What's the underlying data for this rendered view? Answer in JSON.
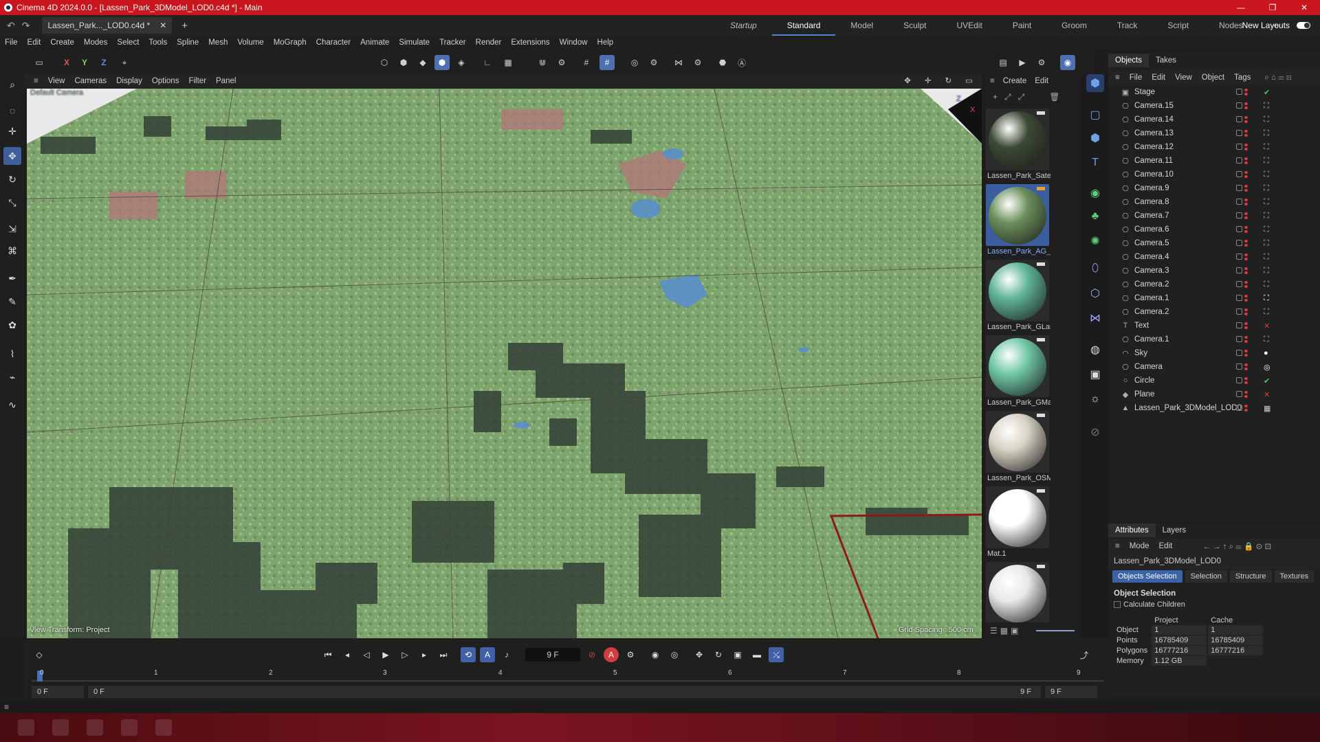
{
  "window": {
    "title": "Cinema 4D 2024.0.0 - [Lassen_Park_3DModel_LOD0.c4d *] - Main",
    "controls": [
      "—",
      "❐",
      "✕"
    ]
  },
  "tabbar": {
    "doc_tab": "Lassen_Park..._LOD0.c4d *",
    "close": "✕",
    "add": "+"
  },
  "layouts": {
    "items": [
      "Startup",
      "Standard",
      "Model",
      "Sculpt",
      "UVEdit",
      "Paint",
      "Groom",
      "Track",
      "Script",
      "Nodes"
    ],
    "add": "+",
    "new_layouts": "New Layouts"
  },
  "menu": [
    "File",
    "Edit",
    "Create",
    "Modes",
    "Select",
    "Tools",
    "Spline",
    "Mesh",
    "Volume",
    "MoGraph",
    "Character",
    "Animate",
    "Simulate",
    "Tracker",
    "Render",
    "Extensions",
    "Window",
    "Help"
  ],
  "toolbar": {
    "x": "X",
    "y": "Y",
    "z": "Z"
  },
  "viewport": {
    "menu": [
      "View",
      "Cameras",
      "Display",
      "Options",
      "Filter",
      "Panel"
    ],
    "view_transform": "View Transform: Project",
    "grid_spacing": "Grid Spacing : 500 cm",
    "camera_label": "Default Camera",
    "axis_z": "Z",
    "axis_x": "X"
  },
  "materials": {
    "menu": [
      "Create",
      "Edit"
    ],
    "items": [
      {
        "name": "Lassen_Park_Satel",
        "color": "#3c4a34"
      },
      {
        "name": "Lassen_Park_AG_L",
        "color": "#6a8f5a"
      },
      {
        "name": "Lassen_Park_GLan",
        "color": "#5fb49a"
      },
      {
        "name": "Lassen_Park_GMa",
        "color": "#6fc8a6"
      },
      {
        "name": "Lassen_Park_OSM",
        "color": "#d8d2c4"
      },
      {
        "name": "Mat.1",
        "color": "#ffffff"
      },
      {
        "name": "",
        "color": "#e8e8e8"
      }
    ]
  },
  "objects_panel": {
    "tabs": [
      "Objects",
      "Takes"
    ],
    "menu": [
      "File",
      "Edit",
      "View",
      "Object",
      "Tags"
    ],
    "items": [
      {
        "name": "Stage",
        "icon": "stage-icon",
        "glyph": "▣",
        "tag": "✔",
        "tag_color": "#3fd06a"
      },
      {
        "name": "Camera.15",
        "icon": "camera-icon",
        "glyph": "⎔",
        "tag": "⛶",
        "tag_color": "#bbbbbb"
      },
      {
        "name": "Camera.14",
        "icon": "camera-icon",
        "glyph": "⎔",
        "tag": "⛶",
        "tag_color": "#bbbbbb"
      },
      {
        "name": "Camera.13",
        "icon": "camera-icon",
        "glyph": "⎔",
        "tag": "⛶",
        "tag_color": "#bbbbbb"
      },
      {
        "name": "Camera.12",
        "icon": "camera-icon",
        "glyph": "⎔",
        "tag": "⛶",
        "tag_color": "#bbbbbb"
      },
      {
        "name": "Camera.11",
        "icon": "camera-icon",
        "glyph": "⎔",
        "tag": "⛶",
        "tag_color": "#bbbbbb"
      },
      {
        "name": "Camera.10",
        "icon": "camera-icon",
        "glyph": "⎔",
        "tag": "⛶",
        "tag_color": "#bbbbbb"
      },
      {
        "name": "Camera.9",
        "icon": "camera-icon",
        "glyph": "⎔",
        "tag": "⛶",
        "tag_color": "#bbbbbb"
      },
      {
        "name": "Camera.8",
        "icon": "camera-icon",
        "glyph": "⎔",
        "tag": "⛶",
        "tag_color": "#bbbbbb"
      },
      {
        "name": "Camera.7",
        "icon": "camera-icon",
        "glyph": "⎔",
        "tag": "⛶",
        "tag_color": "#bbbbbb"
      },
      {
        "name": "Camera.6",
        "icon": "camera-icon",
        "glyph": "⎔",
        "tag": "⛶",
        "tag_color": "#bbbbbb"
      },
      {
        "name": "Camera.5",
        "icon": "camera-icon",
        "glyph": "⎔",
        "tag": "⛶",
        "tag_color": "#bbbbbb"
      },
      {
        "name": "Camera.4",
        "icon": "camera-icon",
        "glyph": "⎔",
        "tag": "⛶",
        "tag_color": "#bbbbbb"
      },
      {
        "name": "Camera.3",
        "icon": "camera-icon",
        "glyph": "⎔",
        "tag": "⛶",
        "tag_color": "#bbbbbb"
      },
      {
        "name": "Camera.2",
        "icon": "camera-icon",
        "glyph": "⎔",
        "tag": "⛶",
        "tag_color": "#bbbbbb"
      },
      {
        "name": "Camera.1",
        "icon": "camera-icon",
        "glyph": "⎔",
        "tag": "⛶",
        "tag_color": "#ffffff"
      },
      {
        "name": "Camera.2",
        "icon": "camera-icon",
        "glyph": "⎔",
        "tag": "⛶",
        "tag_color": "#bbbbbb"
      },
      {
        "name": "Text",
        "icon": "text-spline-icon",
        "glyph": "T",
        "tag": "✕",
        "tag_color": "#e23a3a"
      },
      {
        "name": "Camera.1",
        "icon": "camera-icon",
        "glyph": "⎔",
        "tag": "⛶",
        "tag_color": "#bbbbbb"
      },
      {
        "name": "Sky",
        "icon": "sky-icon",
        "glyph": "◠",
        "tag": "●",
        "tag_color": "#ffffff"
      },
      {
        "name": "Camera",
        "icon": "camera-icon",
        "glyph": "⎔",
        "tag": "◎",
        "tag_color": "#ffffff"
      },
      {
        "name": "Circle",
        "icon": "circle-spline-icon",
        "glyph": "○",
        "tag": "✔",
        "tag_color": "#3fd06a"
      },
      {
        "name": "Plane",
        "icon": "plane-icon",
        "glyph": "◆",
        "tag": "✕",
        "tag_color": "#e23a3a"
      },
      {
        "name": "Lassen_Park_3DModel_LOD0",
        "icon": "polygon-object-icon",
        "glyph": "▲",
        "tag": "▦",
        "tag_color": "#cccccc"
      }
    ]
  },
  "attributes": {
    "tabs": [
      "Attributes",
      "Layers"
    ],
    "menu": [
      "Mode",
      "Edit"
    ],
    "object_name": "Lassen_Park_3DModel_LOD0",
    "sub_tabs": [
      "Objects Selection",
      "Selection",
      "Structure",
      "Textures"
    ],
    "section": "Object Selection",
    "calc_children": "Calculate Children",
    "columns": [
      "",
      "Project",
      "Cache"
    ],
    "rows": [
      {
        "label": "Object",
        "project": "1",
        "cache": "1"
      },
      {
        "label": "Points",
        "project": "16785409",
        "cache": "16785409"
      },
      {
        "label": "Polygons",
        "project": "16777216",
        "cache": "16777216"
      },
      {
        "label": "Memory",
        "project": "1.12 GB",
        "cache": ""
      }
    ]
  },
  "timeline": {
    "current_frame": "9 F",
    "ticks": [
      "0",
      "1",
      "2",
      "3",
      "4",
      "5",
      "6",
      "7",
      "8",
      "9"
    ],
    "range_start": "0 F",
    "range_min": "0 F",
    "range_max": "9 F",
    "range_end": "9 F"
  }
}
